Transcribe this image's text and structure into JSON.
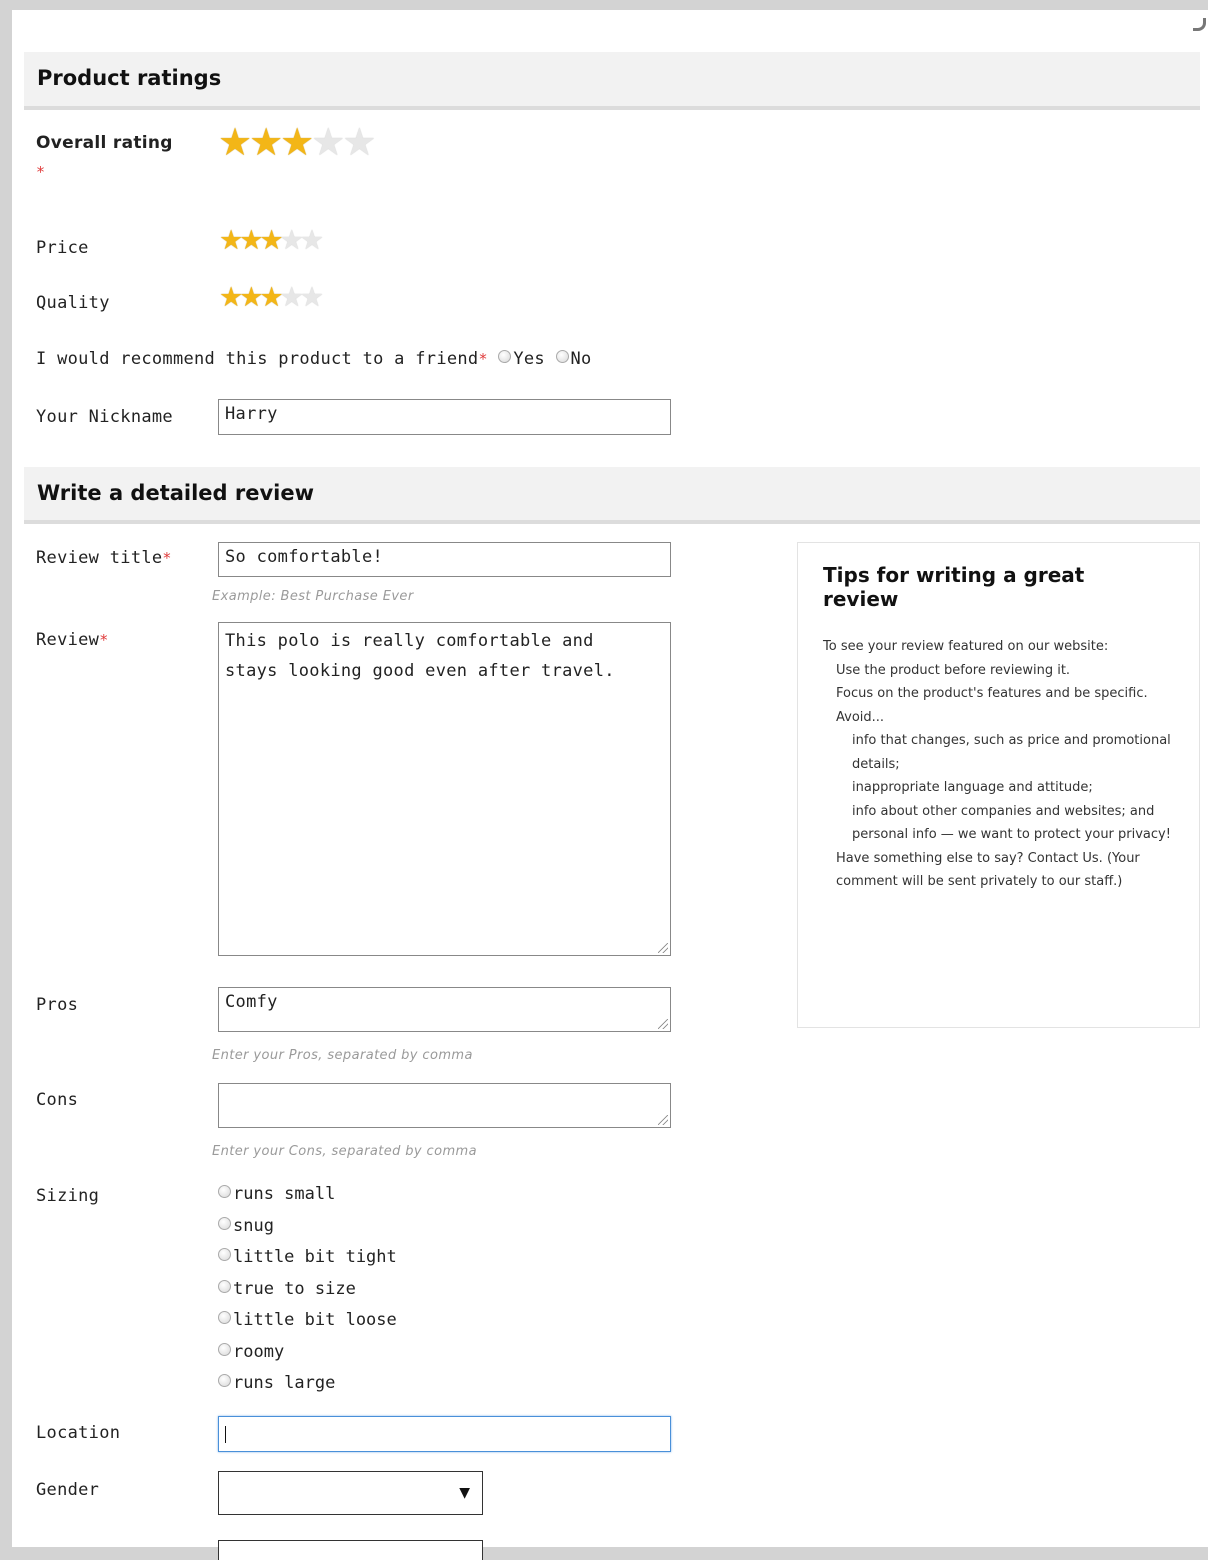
{
  "ratings_section": {
    "title": "Product ratings",
    "overall": {
      "label": "Overall rating",
      "required_mark": "*",
      "stars": 3,
      "max": 5
    },
    "price": {
      "label": "Price",
      "stars": 3,
      "max": 5
    },
    "quality": {
      "label": "Quality",
      "stars": 3,
      "max": 5
    },
    "recommend": {
      "label": "I would recommend this product to a friend",
      "required_mark": "*",
      "yes": "Yes",
      "no": "No"
    },
    "nickname": {
      "label": "Your Nickname",
      "value": "Harry"
    }
  },
  "review_section": {
    "title": "Write a detailed review",
    "review_title": {
      "label": "Review title",
      "required_mark": "*",
      "value": "So comfortable!",
      "hint": "Example: Best Purchase Ever"
    },
    "review": {
      "label": "Review",
      "required_mark": "*",
      "line1": "This polo is really comfortable and",
      "line2": "stays looking good even after travel."
    },
    "pros": {
      "label": "Pros",
      "value": "Comfy",
      "hint": "Enter your Pros, separated by comma"
    },
    "cons": {
      "label": "Cons",
      "value": "",
      "hint": "Enter your Cons, separated by comma"
    },
    "sizing": {
      "label": "Sizing",
      "options": [
        "runs small",
        "snug",
        "little bit tight",
        "true to size",
        "little bit loose",
        "roomy",
        "runs large"
      ]
    },
    "location": {
      "label": "Location",
      "value": ""
    },
    "gender": {
      "label": "Gender",
      "value": ""
    }
  },
  "tips": {
    "title": "Tips for writing a great review",
    "intro": "To see your review featured on our website:",
    "items": [
      "Use the product before reviewing it.",
      "Focus on the product's features and be specific.",
      "Avoid..."
    ],
    "avoid_items": [
      "info that changes, such as price and promotional details;",
      "inappropriate language and attitude;",
      "info about other companies and websites; and",
      "personal info — we want to protect your privacy!"
    ],
    "closing": "Have something else to say? Contact Us. (Your comment will be sent privately to our staff.)"
  },
  "colors": {
    "star_on": "#f3b617",
    "star_off": "#e7e7e7",
    "required": "#e03b3b",
    "header_bg": "#f2f2f2"
  }
}
